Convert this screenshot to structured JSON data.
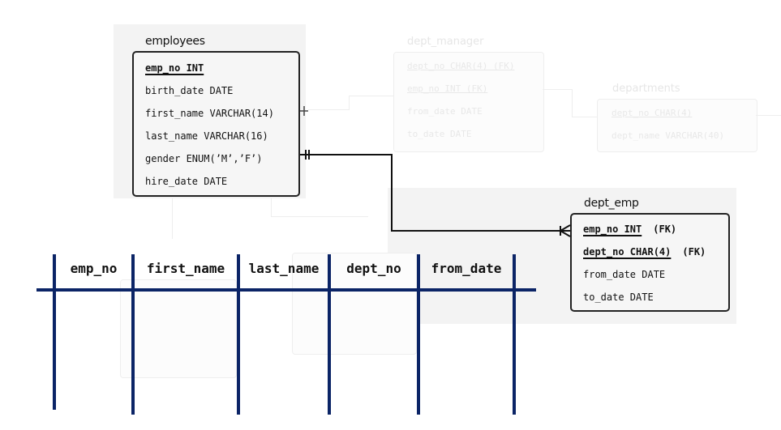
{
  "colors": {
    "table_rule": "#0b2466",
    "entity_border": "#222222",
    "entity_fill": "#f6f6f6",
    "shade": "#f3f3f3"
  },
  "entities": {
    "employees": {
      "title": "employees",
      "attributes": [
        {
          "text": "emp_no INT",
          "pk": true
        },
        {
          "text": "birth_date DATE"
        },
        {
          "text": "first_name VARCHAR(14)"
        },
        {
          "text": "last_name VARCHAR(16)"
        },
        {
          "text": "gender ENUM(’M’,’F’)"
        },
        {
          "text": "hire_date DATE"
        }
      ]
    },
    "dept_emp": {
      "title": "dept_emp",
      "attributes": [
        {
          "text": "emp_no INT",
          "pk": true,
          "fk": "(FK)"
        },
        {
          "text": "dept_no CHAR(4)",
          "pk": true,
          "fk": "(FK)"
        },
        {
          "text": "from_date DATE"
        },
        {
          "text": "to_date DATE"
        }
      ]
    }
  },
  "faded_entities": {
    "dept_manager": {
      "title": "dept_manager",
      "rows": [
        "dept_no CHAR(4)  (FK)",
        "emp_no INT  (FK)",
        "from_date DATE",
        "to_date DATE"
      ]
    },
    "departments": {
      "title": "departments",
      "rows": [
        "dept_no CHAR(4)",
        "dept_name VARCHAR(40)"
      ]
    }
  },
  "relationship": {
    "from": "employees",
    "to": "dept_emp",
    "from_cardinality": "one-and-only-one",
    "to_cardinality": "one-or-many"
  },
  "result_table": {
    "columns": [
      "emp_no",
      "first_name",
      "last_name",
      "dept_no",
      "from_date"
    ],
    "rows": []
  }
}
